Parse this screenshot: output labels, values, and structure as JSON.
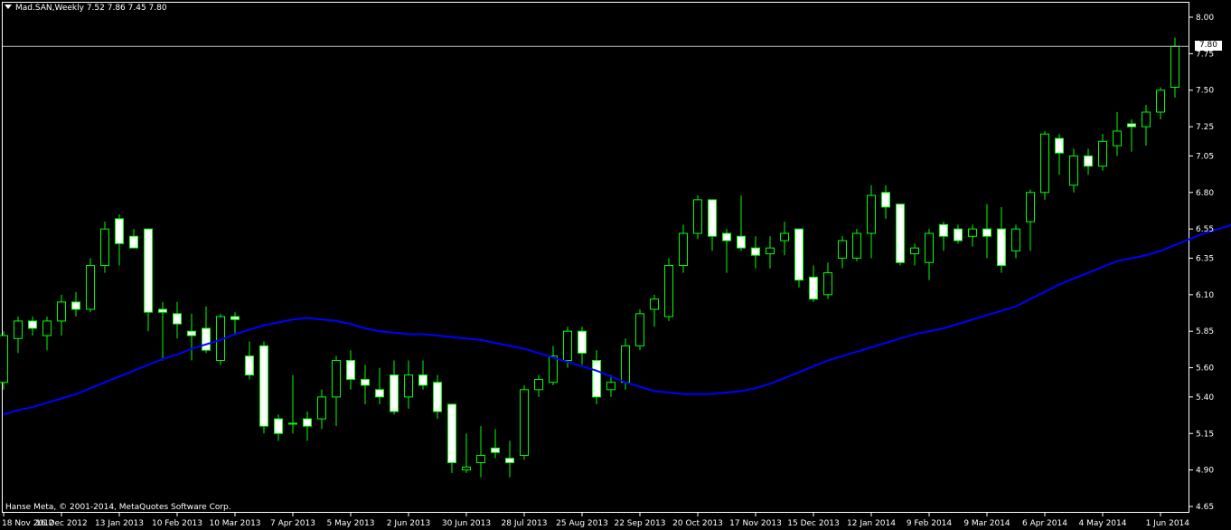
{
  "header": {
    "symbol_label": "Mad.SAN,Weekly  7.52 7.86 7.45 7.80"
  },
  "footer": {
    "copyright": "Hanse Meta, © 2001-2014, MetaQuotes Software Corp."
  },
  "price_box": {
    "label": "7.80"
  },
  "colors": {
    "background": "#000000",
    "grid": "#ffffff",
    "up_fill": "#000000",
    "up_stroke": "#00ff00",
    "down_fill": "#ffffff",
    "down_stroke": "#00ff00",
    "ma": "#0000ff"
  },
  "chart_data": {
    "type": "candlestick",
    "title": "Mad.SAN,Weekly",
    "ylim": [
      4.6,
      8.05
    ],
    "y_ticks": [
      "8.00",
      "7.75",
      "7.50",
      "7.25",
      "7.05",
      "6.80",
      "6.55",
      "6.35",
      "6.10",
      "5.85",
      "5.60",
      "5.40",
      "5.15",
      "4.90",
      "4.65"
    ],
    "y_tick_values": [
      8.0,
      7.75,
      7.5,
      7.25,
      7.05,
      6.8,
      6.55,
      6.35,
      6.1,
      5.85,
      5.6,
      5.4,
      5.15,
      4.9,
      4.65
    ],
    "x_tick_labels": [
      "18 Nov 2012",
      "16 Dec 2012",
      "13 Jan 2013",
      "10 Feb 2013",
      "10 Mar 2013",
      "7 Apr 2013",
      "5 May 2013",
      "2 Jun 2013",
      "30 Jun 2013",
      "28 Jul 2013",
      "25 Aug 2013",
      "22 Sep 2013",
      "20 Oct 2013",
      "17 Nov 2013",
      "15 Dec 2013",
      "12 Jan 2014",
      "9 Feb 2014",
      "9 Mar 2014",
      "6 Apr 2014",
      "4 May 2014",
      "1 Jun 2014"
    ],
    "last_price": 7.8,
    "candles": [
      {
        "o": 5.5,
        "h": 5.85,
        "l": 5.45,
        "c": 5.82
      },
      {
        "o": 5.8,
        "h": 5.95,
        "l": 5.7,
        "c": 5.92
      },
      {
        "o": 5.92,
        "h": 5.95,
        "l": 5.82,
        "c": 5.87
      },
      {
        "o": 5.82,
        "h": 5.95,
        "l": 5.72,
        "c": 5.92
      },
      {
        "o": 5.92,
        "h": 6.1,
        "l": 5.82,
        "c": 6.05
      },
      {
        "o": 6.05,
        "h": 6.12,
        "l": 5.95,
        "c": 6.0
      },
      {
        "o": 6.0,
        "h": 6.35,
        "l": 5.98,
        "c": 6.3
      },
      {
        "o": 6.3,
        "h": 6.6,
        "l": 6.25,
        "c": 6.55
      },
      {
        "o": 6.62,
        "h": 6.65,
        "l": 6.3,
        "c": 6.45
      },
      {
        "o": 6.5,
        "h": 6.55,
        "l": 6.45,
        "c": 6.42
      },
      {
        "o": 6.55,
        "h": 6.55,
        "l": 5.85,
        "c": 5.98
      },
      {
        "o": 6.0,
        "h": 6.05,
        "l": 5.65,
        "c": 5.98
      },
      {
        "o": 5.97,
        "h": 6.05,
        "l": 5.8,
        "c": 5.9
      },
      {
        "o": 5.85,
        "h": 5.97,
        "l": 5.65,
        "c": 5.82
      },
      {
        "o": 5.87,
        "h": 6.02,
        "l": 5.7,
        "c": 5.72
      },
      {
        "o": 5.65,
        "h": 5.97,
        "l": 5.62,
        "c": 5.95
      },
      {
        "o": 5.95,
        "h": 5.98,
        "l": 5.83,
        "c": 5.93
      },
      {
        "o": 5.68,
        "h": 5.78,
        "l": 5.52,
        "c": 5.55
      },
      {
        "o": 5.75,
        "h": 5.78,
        "l": 5.15,
        "c": 5.2
      },
      {
        "o": 5.25,
        "h": 5.28,
        "l": 5.1,
        "c": 5.15
      },
      {
        "o": 5.22,
        "h": 5.55,
        "l": 5.15,
        "c": 5.22
      },
      {
        "o": 5.25,
        "h": 5.3,
        "l": 5.1,
        "c": 5.2
      },
      {
        "o": 5.25,
        "h": 5.45,
        "l": 5.18,
        "c": 5.4
      },
      {
        "o": 5.4,
        "h": 5.68,
        "l": 5.2,
        "c": 5.65
      },
      {
        "o": 5.65,
        "h": 5.72,
        "l": 5.45,
        "c": 5.52
      },
      {
        "o": 5.52,
        "h": 5.62,
        "l": 5.35,
        "c": 5.48
      },
      {
        "o": 5.45,
        "h": 5.6,
        "l": 5.35,
        "c": 5.4
      },
      {
        "o": 5.55,
        "h": 5.65,
        "l": 5.28,
        "c": 5.3
      },
      {
        "o": 5.4,
        "h": 5.65,
        "l": 5.32,
        "c": 5.55
      },
      {
        "o": 5.55,
        "h": 5.65,
        "l": 5.45,
        "c": 5.48
      },
      {
        "o": 5.5,
        "h": 5.55,
        "l": 5.25,
        "c": 5.3
      },
      {
        "o": 5.35,
        "h": 5.35,
        "l": 4.88,
        "c": 4.95
      },
      {
        "o": 4.9,
        "h": 5.15,
        "l": 4.88,
        "c": 4.92
      },
      {
        "o": 4.95,
        "h": 5.2,
        "l": 4.85,
        "c": 5.0
      },
      {
        "o": 5.05,
        "h": 5.18,
        "l": 4.98,
        "c": 5.02
      },
      {
        "o": 4.98,
        "h": 5.1,
        "l": 4.85,
        "c": 4.95
      },
      {
        "o": 5.0,
        "h": 5.48,
        "l": 4.97,
        "c": 5.45
      },
      {
        "o": 5.45,
        "h": 5.55,
        "l": 5.4,
        "c": 5.52
      },
      {
        "o": 5.5,
        "h": 5.75,
        "l": 5.48,
        "c": 5.68
      },
      {
        "o": 5.65,
        "h": 5.88,
        "l": 5.6,
        "c": 5.85
      },
      {
        "o": 5.85,
        "h": 5.88,
        "l": 5.62,
        "c": 5.7
      },
      {
        "o": 5.65,
        "h": 5.72,
        "l": 5.35,
        "c": 5.4
      },
      {
        "o": 5.45,
        "h": 5.55,
        "l": 5.4,
        "c": 5.5
      },
      {
        "o": 5.5,
        "h": 5.8,
        "l": 5.45,
        "c": 5.75
      },
      {
        "o": 5.75,
        "h": 6.0,
        "l": 5.72,
        "c": 5.97
      },
      {
        "o": 6.0,
        "h": 6.1,
        "l": 5.88,
        "c": 6.07
      },
      {
        "o": 5.95,
        "h": 6.35,
        "l": 5.92,
        "c": 6.3
      },
      {
        "o": 6.3,
        "h": 6.58,
        "l": 6.25,
        "c": 6.52
      },
      {
        "o": 6.52,
        "h": 6.78,
        "l": 6.48,
        "c": 6.75
      },
      {
        "o": 6.75,
        "h": 6.75,
        "l": 6.4,
        "c": 6.5
      },
      {
        "o": 6.52,
        "h": 6.55,
        "l": 6.25,
        "c": 6.47
      },
      {
        "o": 6.5,
        "h": 6.78,
        "l": 6.4,
        "c": 6.42
      },
      {
        "o": 6.42,
        "h": 6.5,
        "l": 6.28,
        "c": 6.37
      },
      {
        "o": 6.38,
        "h": 6.5,
        "l": 6.28,
        "c": 6.42
      },
      {
        "o": 6.47,
        "h": 6.6,
        "l": 6.37,
        "c": 6.52
      },
      {
        "o": 6.55,
        "h": 6.55,
        "l": 6.15,
        "c": 6.2
      },
      {
        "o": 6.22,
        "h": 6.3,
        "l": 6.05,
        "c": 6.07
      },
      {
        "o": 6.1,
        "h": 6.32,
        "l": 6.07,
        "c": 6.25
      },
      {
        "o": 6.35,
        "h": 6.5,
        "l": 6.28,
        "c": 6.47
      },
      {
        "o": 6.35,
        "h": 6.55,
        "l": 6.33,
        "c": 6.52
      },
      {
        "o": 6.52,
        "h": 6.85,
        "l": 6.35,
        "c": 6.78
      },
      {
        "o": 6.8,
        "h": 6.85,
        "l": 6.62,
        "c": 6.7
      },
      {
        "o": 6.72,
        "h": 6.72,
        "l": 6.3,
        "c": 6.32
      },
      {
        "o": 6.38,
        "h": 6.45,
        "l": 6.3,
        "c": 6.42
      },
      {
        "o": 6.32,
        "h": 6.55,
        "l": 6.2,
        "c": 6.52
      },
      {
        "o": 6.58,
        "h": 6.6,
        "l": 6.4,
        "c": 6.5
      },
      {
        "o": 6.55,
        "h": 6.58,
        "l": 6.45,
        "c": 6.47
      },
      {
        "o": 6.5,
        "h": 6.58,
        "l": 6.43,
        "c": 6.55
      },
      {
        "o": 6.55,
        "h": 6.72,
        "l": 6.35,
        "c": 6.5
      },
      {
        "o": 6.55,
        "h": 6.7,
        "l": 6.25,
        "c": 6.3
      },
      {
        "o": 6.4,
        "h": 6.58,
        "l": 6.35,
        "c": 6.55
      },
      {
        "o": 6.6,
        "h": 6.82,
        "l": 6.4,
        "c": 6.8
      },
      {
        "o": 6.8,
        "h": 7.22,
        "l": 6.75,
        "c": 7.2
      },
      {
        "o": 7.17,
        "h": 7.2,
        "l": 6.92,
        "c": 7.07
      },
      {
        "o": 6.85,
        "h": 7.1,
        "l": 6.8,
        "c": 7.05
      },
      {
        "o": 7.05,
        "h": 7.1,
        "l": 6.92,
        "c": 6.98
      },
      {
        "o": 6.98,
        "h": 7.2,
        "l": 6.95,
        "c": 7.15
      },
      {
        "o": 7.12,
        "h": 7.35,
        "l": 7.05,
        "c": 7.22
      },
      {
        "o": 7.27,
        "h": 7.3,
        "l": 7.08,
        "c": 7.25
      },
      {
        "o": 7.25,
        "h": 7.4,
        "l": 7.12,
        "c": 7.35
      },
      {
        "o": 7.35,
        "h": 7.52,
        "l": 7.3,
        "c": 7.5
      },
      {
        "o": 7.52,
        "h": 7.86,
        "l": 7.45,
        "c": 7.8
      }
    ],
    "ma": [
      5.28,
      5.31,
      5.33,
      5.36,
      5.39,
      5.42,
      5.46,
      5.5,
      5.54,
      5.58,
      5.62,
      5.66,
      5.69,
      5.73,
      5.76,
      5.79,
      5.83,
      5.86,
      5.89,
      5.91,
      5.93,
      5.94,
      5.93,
      5.92,
      5.9,
      5.87,
      5.85,
      5.84,
      5.83,
      5.83,
      5.82,
      5.81,
      5.8,
      5.79,
      5.77,
      5.75,
      5.73,
      5.7,
      5.67,
      5.64,
      5.61,
      5.58,
      5.54,
      5.5,
      5.47,
      5.44,
      5.43,
      5.42,
      5.42,
      5.42,
      5.43,
      5.44,
      5.46,
      5.49,
      5.53,
      5.57,
      5.61,
      5.65,
      5.68,
      5.71,
      5.74,
      5.77,
      5.8,
      5.83,
      5.85,
      5.87,
      5.9,
      5.93,
      5.96,
      5.99,
      6.02,
      6.07,
      6.12,
      6.17,
      6.21,
      6.25,
      6.29,
      6.33,
      6.35,
      6.37,
      6.4,
      6.44,
      6.48,
      6.52,
      6.55,
      6.58,
      6.6,
      6.62,
      6.64,
      6.66,
      6.69,
      6.72
    ]
  }
}
